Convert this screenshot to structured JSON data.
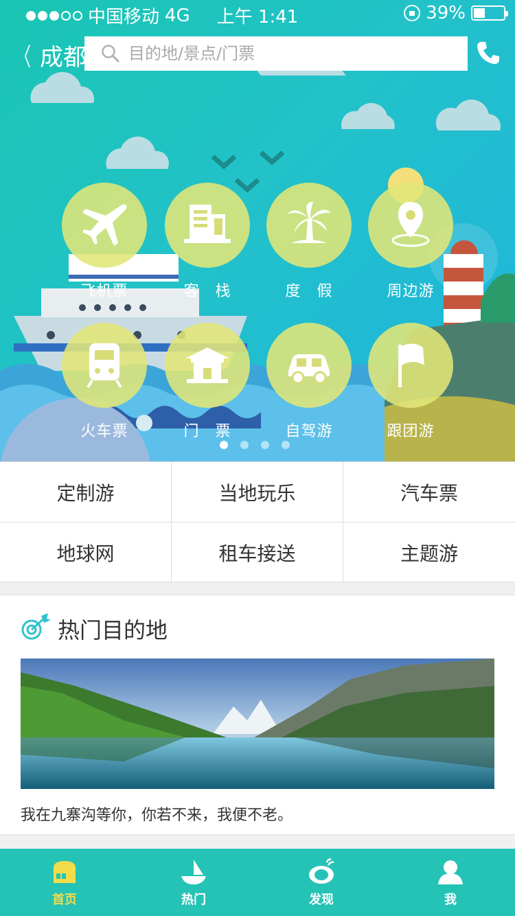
{
  "status": {
    "carrier": "中国移动",
    "network": "4G",
    "time": "上午 1:41",
    "battery": "39%"
  },
  "nav": {
    "city": "成都",
    "search_placeholder": "目的地/景点/门票"
  },
  "categories": [
    {
      "label": "飞机票",
      "icon": "plane-icon"
    },
    {
      "label": "客　栈",
      "icon": "inn-icon"
    },
    {
      "label": "度　假",
      "icon": "palm-tree-icon"
    },
    {
      "label": "周边游",
      "icon": "location-pin-icon"
    },
    {
      "label": "火车票",
      "icon": "train-icon"
    },
    {
      "label": "门　票",
      "icon": "temple-icon"
    },
    {
      "label": "自驾游",
      "icon": "car-icon"
    },
    {
      "label": "跟团游",
      "icon": "flag-icon"
    }
  ],
  "carousel": {
    "pages": 4,
    "current": 1
  },
  "quick_links": [
    "定制游",
    "当地玩乐",
    "汽车票",
    "地球网",
    "租车接送",
    "主题游"
  ],
  "hot": {
    "title": "热门目的地",
    "caption": "我在九寨沟等你，你若不来，我便不老。"
  },
  "tabs": [
    {
      "label": "首页",
      "icon": "home-icon",
      "active": true
    },
    {
      "label": "热门",
      "icon": "sailboat-icon",
      "active": false
    },
    {
      "label": "发现",
      "icon": "discover-icon",
      "active": false
    },
    {
      "label": "我",
      "icon": "user-icon",
      "active": false
    }
  ],
  "colors": {
    "teal": "#25c3b6",
    "accent_yellow": "#f3dc4a",
    "icon_circle": "#e1e678"
  }
}
